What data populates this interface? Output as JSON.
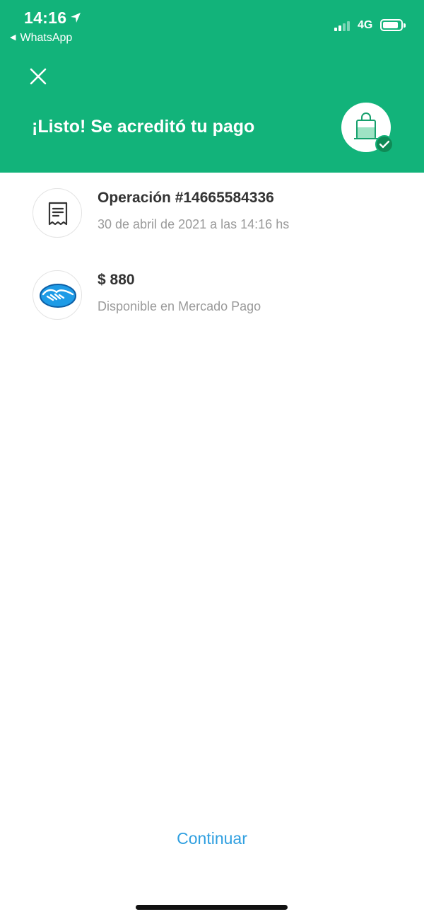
{
  "status_bar": {
    "time": "14:16",
    "back_app": "WhatsApp",
    "network": "4G"
  },
  "header": {
    "title": "¡Listo! Se acreditó tu pago",
    "background_color": "#12b37a",
    "badge_icon": "shopping-bag-icon",
    "status_icon": "check-icon"
  },
  "rows": [
    {
      "icon": "receipt-icon",
      "title": "Operación #14665584336",
      "subtitle": "30 de abril de 2021 a las 14:16 hs"
    },
    {
      "icon": "mercado-pago-logo",
      "title": "$ 880",
      "subtitle": "Disponible en Mercado Pago"
    }
  ],
  "actions": {
    "continue_label": "Continuar",
    "link_color": "#2f9fe0"
  }
}
